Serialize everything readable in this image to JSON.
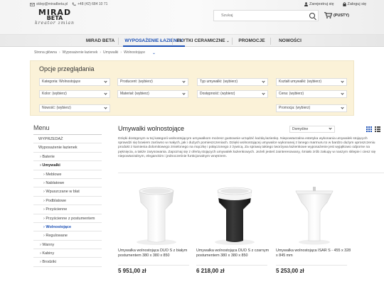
{
  "header": {
    "logo": {
      "line1": "MIRAD",
      "line2": "BETA",
      "tagline": "kreator zmian"
    },
    "email": "sklep@miradbeta.pl",
    "phone": "+48 (42) 684 10 71",
    "search_placeholder": "Szukaj",
    "register": "Zarejestruj się",
    "login": "Zaloguj się",
    "cart": "(PUSTY)"
  },
  "nav": {
    "items": [
      {
        "label": "MIRAD BETA"
      },
      {
        "label": "WYPOSAŻENIE ŁAZIENEK"
      },
      {
        "label": "PŁYTKI CERAMICZNE"
      },
      {
        "label": "PROMOCJE"
      },
      {
        "label": "NOWOŚCI"
      }
    ]
  },
  "breadcrumb": [
    "Strona główna",
    "Wyposażenie łazienek",
    "Umywalki",
    "Wolnostojące"
  ],
  "filters": {
    "title": "Opcje przeglądania",
    "fields": [
      "Kategoria: Wolnostojące",
      "Producent: (wybierz)",
      "Typ umywalki: (wybierz)",
      "Kształt umywalki: (wybierz)",
      "Kolor: (wybierz)",
      "Materiał: (wybierz)",
      "Dostępność: (wybierz)",
      "Cena: (wybierz)",
      "Nowość: (wybierz)",
      "Promocja: (wybierz)"
    ]
  },
  "sidebar": {
    "title": "Menu",
    "items": [
      "WYPRZEDAŻ",
      "Wyposażenie łazienek",
      "Baterie",
      "Umywalki",
      "Meblowe",
      "Nablatowe",
      "Wpuszczane w blat",
      "Podblatowe",
      "Przyścienne",
      "Przyścienne z postumentem",
      "Wolnostojące",
      "Regulowane",
      "Wanny",
      "Kabiny",
      "Brodziki"
    ]
  },
  "main": {
    "title": "Umywalki wolnostojące",
    "sort": "Domyślne",
    "description": "Dzięki dostępnym w tej kategorii wolnostojącym umywalkom możesz gustownie urządzić każdą łazienkę. Niepowtarzalna estetyka wykonania umywalek stojących sprawdzi się bowiem zarówno w małych, jak i dużych pomieszczeniach. Dzięki wolnostojącej umywalce wykonanej z lanego marmuru to w bardzo dużym uproszczeniu produkt z kamienia dolomitowego zmielonego na mączkę i połączonego z żywicą. Za sprawą takiego tworzywa łazienkowe wyposażenie jest wyjątkowo odporne na pęknięcia, a także zarysowania. Zapoznaj się z ofertą stojących umywalek łazienkowych. Jeżeli jesteś zainteresowany, śmiało zrób zakupy w naszym sklepie i ciesz się niepowtarzalnym, eleganckim i jednocześnie funkcjonalnym wnętrzem.",
    "products": [
      {
        "name": "Umywalka wolnostojąca DUO S z białym postumentem 380 x 380 x 850",
        "price": "5 951,00 zł"
      },
      {
        "name": "Umywalka wolnostojąca DUO S z czarnym postumentem 380 x 380 x 850",
        "price": "6 218,00 zł"
      },
      {
        "name": "Umywalka wolnostojąca ISAR S - 455 x 328 x 845 mm",
        "price": "5 253,00 zł"
      }
    ]
  },
  "colors": {
    "accent": "#1a4fb5",
    "filter_bg": "#fbf2d8"
  }
}
